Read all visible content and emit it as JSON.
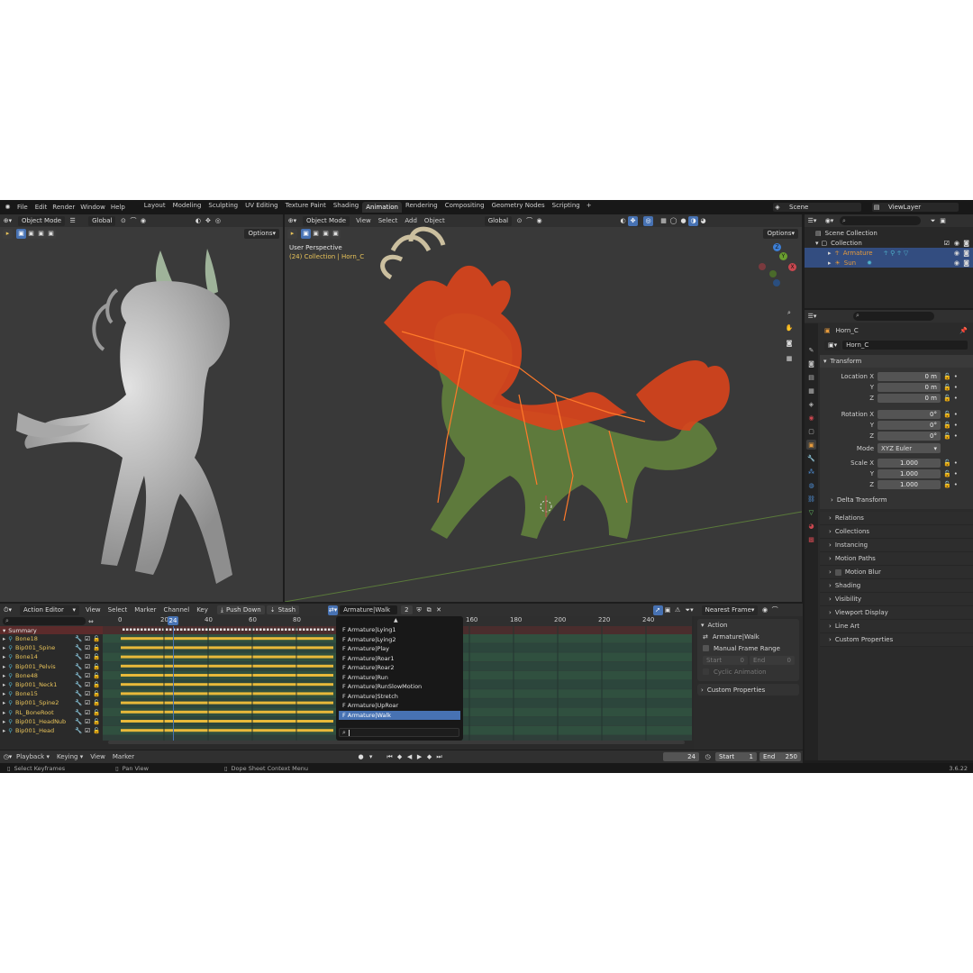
{
  "top_menu": {
    "items": [
      "File",
      "Edit",
      "Render",
      "Window",
      "Help"
    ],
    "workspaces": [
      "Layout",
      "Modeling",
      "Sculpting",
      "UV Editing",
      "Texture Paint",
      "Shading",
      "Animation",
      "Rendering",
      "Compositing",
      "Geometry Nodes",
      "Scripting"
    ],
    "active_workspace": "Animation",
    "add_tab": "+",
    "scene": "Scene",
    "view_layer": "ViewLayer"
  },
  "left_viewport": {
    "mode": "Object Mode",
    "orientation": "Global",
    "options": "Options"
  },
  "main_viewport": {
    "mode": "Object Mode",
    "menus": [
      "View",
      "Select",
      "Add",
      "Object"
    ],
    "orientation": "Global",
    "options": "Options",
    "view_name": "User Perspective",
    "context": "(24) Collection | Horn_C",
    "gizmo_axes": {
      "z": "Z",
      "y": "Y",
      "x": "X"
    }
  },
  "outliner": {
    "search_placeholder": "",
    "items": [
      {
        "label": "Scene Collection",
        "color": "#d0d0d0"
      },
      {
        "label": "Collection",
        "color": "#d0d0d0"
      },
      {
        "label": "Armature",
        "color": "#e59a3c"
      },
      {
        "label": "Sun",
        "color": "#e59a3c"
      }
    ]
  },
  "properties": {
    "object_name": "Horn_C",
    "datablock": "Horn_C",
    "transform_title": "Transform",
    "location": {
      "label": "Location X",
      "x": "0 m",
      "y": "0 m",
      "z": "0 m"
    },
    "rotation": {
      "label": "Rotation X",
      "x": "0°",
      "y": "0°",
      "z": "0°"
    },
    "mode": {
      "label": "Mode",
      "value": "XYZ Euler"
    },
    "scale": {
      "label": "Scale X",
      "x": "1.000",
      "y": "1.000",
      "z": "1.000"
    },
    "axis_labels": {
      "y": "Y",
      "z": "Z"
    },
    "delta": "Delta Transform",
    "panels": [
      "Relations",
      "Collections",
      "Instancing",
      "Motion Paths",
      "Motion Blur",
      "Shading",
      "Visibility",
      "Viewport Display",
      "Line Art",
      "Custom Properties"
    ]
  },
  "action_editor": {
    "editor": "Action Editor",
    "menus": [
      "View",
      "Select",
      "Marker",
      "Channel",
      "Key"
    ],
    "push_down": "Push Down",
    "stash": "Stash",
    "action": "Armature|Walk",
    "users": "2",
    "snap": "Nearest Frame",
    "current_frame_badge": "24",
    "ruler": [
      "0",
      "20",
      "40",
      "60",
      "80",
      "160",
      "180",
      "200",
      "220",
      "240"
    ],
    "summary": "Summary",
    "channels": [
      "Bone18",
      "Bip001_Spine",
      "Bone14",
      "Bip001_Pelvis",
      "Bone48",
      "Bip001_Neck1",
      "Bone15",
      "Bip001_Spine2",
      "RL_BoneRoot",
      "Bip001_HeadNub",
      "Bip001_Head"
    ]
  },
  "action_menu": {
    "items": [
      "Armature|Lying1",
      "Armature|Lying2",
      "Armature|Play",
      "Armature|Roar1",
      "Armature|Roar2",
      "Armature|Run",
      "Armature|RunSlowMotion",
      "Armature|Stretch",
      "Armature|UpRoar",
      "Armature|Walk"
    ],
    "prefix": "F",
    "selected_index": 9
  },
  "sidebar": {
    "action_panel": "Action",
    "action_name": "Armature|Walk",
    "manual_frame_range": "Manual Frame Range",
    "start_label": "Start",
    "start_value": "0",
    "end_label": "End",
    "end_value": "0",
    "cyclic": "Cyclic Animation",
    "custom_props": "Custom Properties"
  },
  "timeline": {
    "menus": [
      "Playback",
      "Keying",
      "View",
      "Marker"
    ],
    "current_frame": "24",
    "start_label": "Start",
    "start": "1",
    "end_label": "End",
    "end": "250"
  },
  "status_bar": {
    "items": [
      "Select Keyframes",
      "Pan View",
      "Dope Sheet Context Menu"
    ],
    "version": "3.6.22"
  },
  "colors": {
    "accent": "#4772b3",
    "selected_orange": "#e59a3c",
    "keyframe": "#e8b93a",
    "x_axis": "#c9474f",
    "y_axis": "#6a9e2f",
    "z_axis": "#3d7fd6"
  }
}
